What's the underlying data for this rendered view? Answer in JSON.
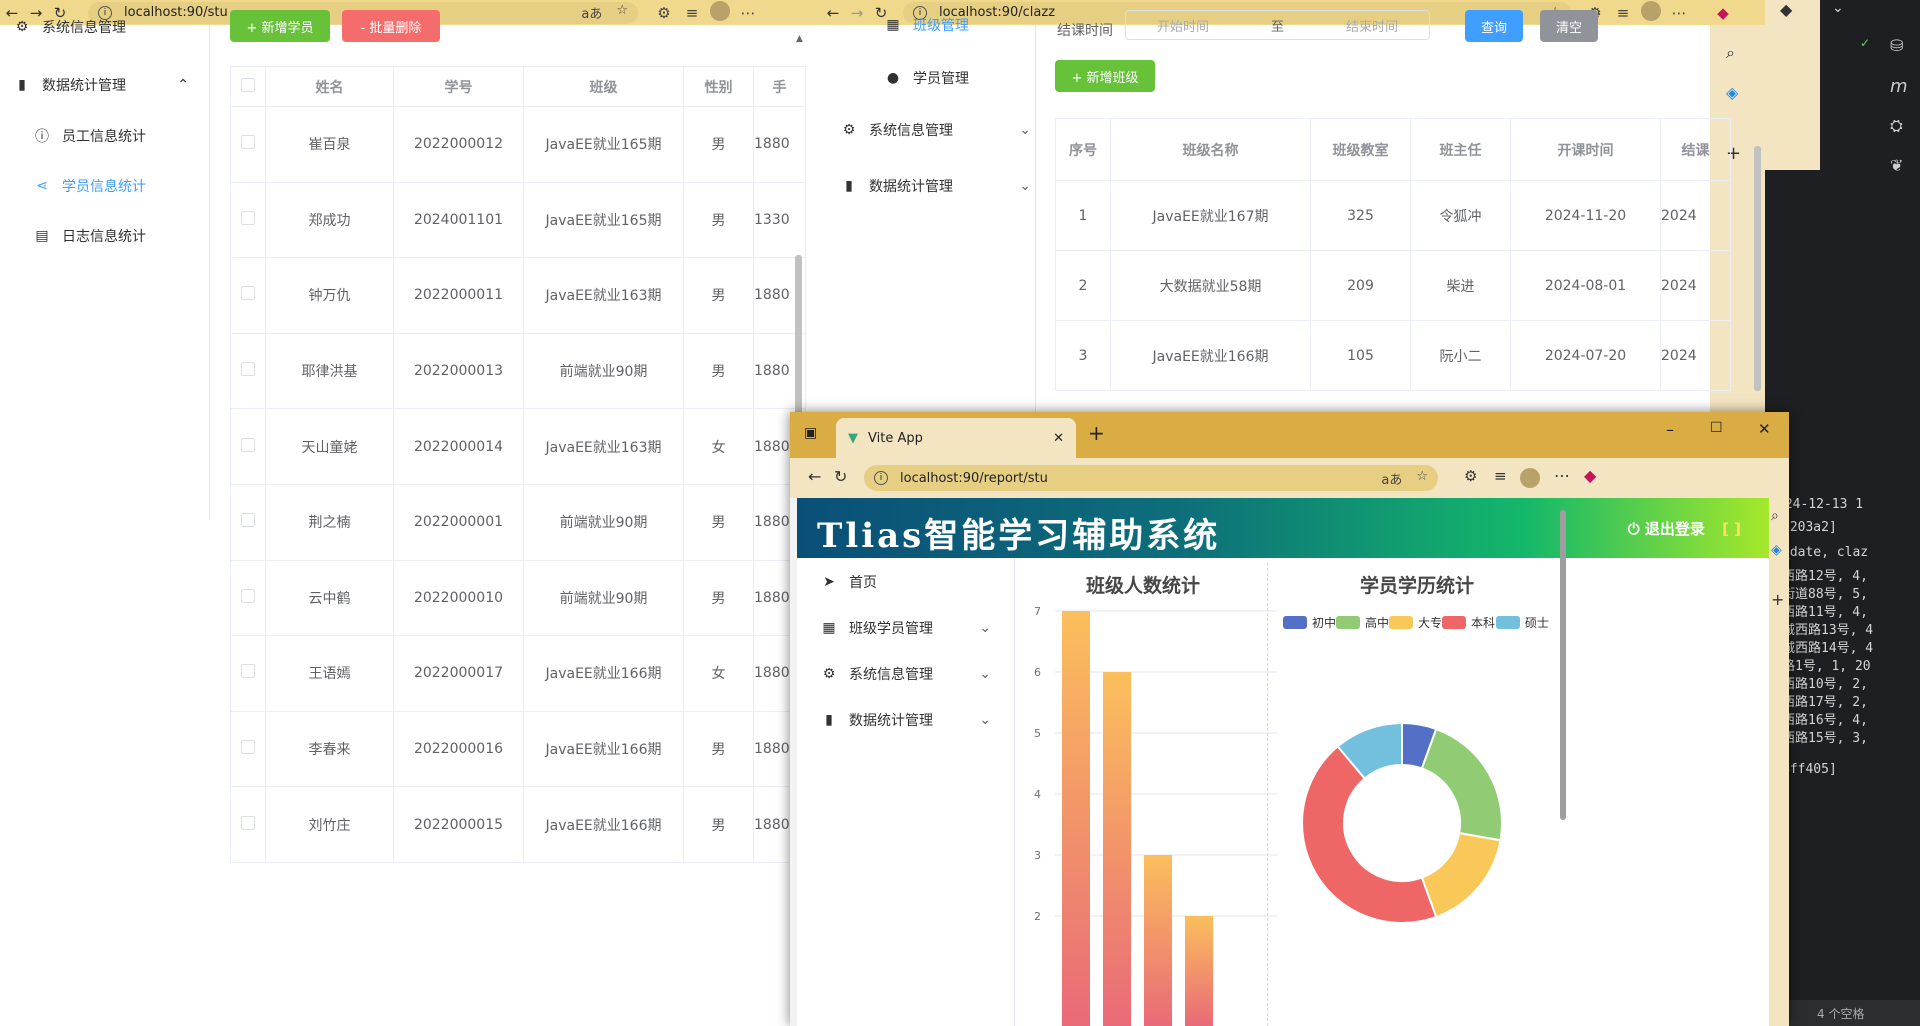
{
  "win1": {
    "url": "localhost:90/stu",
    "sidebar": {
      "top_cut_label": "系统信息管理",
      "group_label": "数据统计管理",
      "items": [
        {
          "label": "员工信息统计",
          "icon": "info-circle-icon"
        },
        {
          "label": "学员信息统计",
          "icon": "share-icon"
        },
        {
          "label": "日志信息统计",
          "icon": "document-icon"
        }
      ]
    },
    "buttons": {
      "add": "+ 新增学员",
      "batch_delete": "- 批量删除"
    },
    "table": {
      "headers": [
        "姓名",
        "学号",
        "班级",
        "性别",
        "手"
      ],
      "rows": [
        [
          "崔百泉",
          "2022000012",
          "JavaEE就业165期",
          "男",
          "1880"
        ],
        [
          "郑成功",
          "2024001101",
          "JavaEE就业165期",
          "男",
          "1330"
        ],
        [
          "钟万仇",
          "2022000011",
          "JavaEE就业163期",
          "男",
          "1880"
        ],
        [
          "耶律洪基",
          "2022000013",
          "前端就业90期",
          "男",
          "1880"
        ],
        [
          "天山童姥",
          "2022000014",
          "JavaEE就业163期",
          "女",
          "1880"
        ],
        [
          "荆之楠",
          "2022000001",
          "前端就业90期",
          "男",
          "1880"
        ],
        [
          "云中鹤",
          "2022000010",
          "前端就业90期",
          "男",
          "1880"
        ],
        [
          "王语嫣",
          "2022000017",
          "JavaEE就业166期",
          "女",
          "1880"
        ],
        [
          "李春来",
          "2022000016",
          "JavaEE就业166期",
          "男",
          "1880"
        ],
        [
          "刘竹庄",
          "2022000015",
          "JavaEE就业166期",
          "男",
          "1880"
        ]
      ]
    }
  },
  "win2": {
    "url": "localhost:90/clazz",
    "sidebar": {
      "top_cut_label": "班级管理",
      "items": [
        {
          "label": "学员管理",
          "icon": "user-icon"
        },
        {
          "label": "系统信息管理",
          "icon": "gear-icon"
        },
        {
          "label": "数据统计管理",
          "icon": "bar-chart-icon"
        }
      ]
    },
    "filter": {
      "label": "结课时间",
      "start_placeholder": "开始时间",
      "separator": "至",
      "end_placeholder": "结束时间",
      "query": "查询",
      "clear": "清空"
    },
    "add_button": "+ 新增班级",
    "table": {
      "headers": [
        "序号",
        "班级名称",
        "班级教室",
        "班主任",
        "开课时间",
        "结课"
      ],
      "rows": [
        [
          "1",
          "JavaEE就业167期",
          "325",
          "令狐冲",
          "2024-11-20",
          "2024"
        ],
        [
          "2",
          "大数据就业58期",
          "209",
          "柴进",
          "2024-08-01",
          "2024"
        ],
        [
          "3",
          "JavaEE就业166期",
          "105",
          "阮小二",
          "2024-07-20",
          "2024"
        ]
      ]
    }
  },
  "win3": {
    "tab_title": "Vite App",
    "url": "localhost:90/report/stu",
    "brand": "Tlias智能学习辅助系统",
    "logout": "退出登录",
    "menu": [
      {
        "label": "首页",
        "icon": "send-icon"
      },
      {
        "label": "班级学员管理",
        "icon": "grid-icon"
      },
      {
        "label": "系统信息管理",
        "icon": "gear-icon"
      },
      {
        "label": "数据统计管理",
        "icon": "bar-chart-icon"
      }
    ],
    "chart_titles": {
      "bar": "班级人数统计",
      "pie": "学员学历统计"
    }
  },
  "ide": {
    "log_lines": [
      "024-12-13 1",
      "e203a2]",
      "_date, claz",
      "西路12号, 4,",
      "街道88号, 5,",
      "西路11号, 4,",
      "城西路13号, 4",
      "城西路14号, 4",
      "路1号, 1, 20",
      "西路10号, 2,",
      "西路17号, 2,",
      "西路16号, 4,",
      "西路15号, 3,",
      "4ff405]"
    ],
    "status": "4 个空格"
  },
  "chart_data": [
    {
      "type": "bar",
      "title": "班级人数统计",
      "values": [
        7,
        6,
        3,
        2
      ],
      "ylim": [
        2,
        7
      ],
      "yticks": [
        2,
        3,
        4,
        5,
        6,
        7
      ],
      "grid": true
    },
    {
      "type": "pie",
      "title": "学员学历统计",
      "legend": [
        "初中",
        "高中",
        "大专",
        "本科",
        "硕士"
      ],
      "legend_position": "top",
      "colors": [
        "#5470c6",
        "#91cc75",
        "#fac858",
        "#ee6666",
        "#73c0de"
      ],
      "values": [
        1,
        4,
        3,
        8,
        2
      ],
      "donut": true
    }
  ]
}
